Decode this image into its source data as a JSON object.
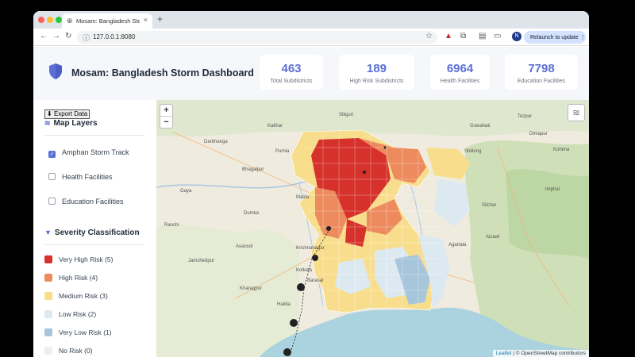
{
  "browser": {
    "tab_title": "Mosam: Bangladesh Storm Da",
    "url": "127.0.0.1:8080",
    "relaunch_label": "Relaunch to update",
    "profile_initial": "N"
  },
  "header": {
    "title": "Mosam: Bangladesh Storm Dashboard",
    "stats": [
      {
        "value": "463",
        "label": "Total Subdistricts"
      },
      {
        "value": "189",
        "label": "High Risk Subdistricts"
      },
      {
        "value": "6964",
        "label": "Health Facilities"
      },
      {
        "value": "7798",
        "label": "Education Facilities"
      }
    ]
  },
  "sidebar": {
    "export_label": "Export Data",
    "layers_title": "Map Layers",
    "layers": [
      {
        "label": "Amphan Storm Track",
        "checked": true
      },
      {
        "label": "Health Facilities",
        "checked": false
      },
      {
        "label": "Education Facilities",
        "checked": false
      }
    ],
    "severity_title": "Severity Classification",
    "severity": [
      {
        "label": "Very High Risk (5)",
        "color": "#d7312b"
      },
      {
        "label": "High Risk (4)",
        "color": "#ee8b5e"
      },
      {
        "label": "Medium Risk (3)",
        "color": "#f8de8c"
      },
      {
        "label": "Low Risk (2)",
        "color": "#dde9f1"
      },
      {
        "label": "Very Low Risk (1)",
        "color": "#a7c6dc"
      },
      {
        "label": "No Risk (0)",
        "color": "#eeeeee"
      }
    ]
  },
  "map": {
    "zoom_in": "+",
    "zoom_out": "−",
    "attribution_link": "Leaflet",
    "attribution_text": " | © OpenStreetMap contributors",
    "place_labels": [
      "Darbhanga",
      "Bhagalpur",
      "Gaya",
      "Purnia",
      "Dumka",
      "Asansol",
      "Krishnanagar",
      "Kolkata",
      "Barasat",
      "Kharagpur",
      "Haldia",
      "Agartala",
      "Aizawl",
      "Silchar",
      "Shillong",
      "Imphal",
      "Kohima",
      "Dimapur",
      "Guwahati",
      "Tezpur",
      "Siliguri",
      "Katihar",
      "Malda",
      "Jamshedpur",
      "Ranchi"
    ]
  }
}
